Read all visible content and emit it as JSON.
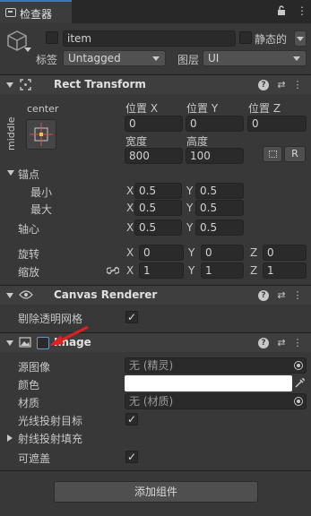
{
  "tab": {
    "title": "检查器"
  },
  "object": {
    "name": "item",
    "static_label": "静态的",
    "tag_label": "标签",
    "tag_value": "Untagged",
    "layer_label": "图层",
    "layer_value": "UI"
  },
  "rect_transform": {
    "title": "Rect Transform",
    "anchor_h": "center",
    "anchor_v": "middle",
    "pos_x_label": "位置 X",
    "pos_x": "0",
    "pos_y_label": "位置 Y",
    "pos_y": "0",
    "pos_z_label": "位置 Z",
    "pos_z": "0",
    "width_label": "宽度",
    "width": "800",
    "height_label": "高度",
    "height": "100",
    "r_button": "R",
    "anchors_label": "锚点",
    "min_label": "最小",
    "min_x": "0.5",
    "min_y": "0.5",
    "max_label": "最大",
    "max_x": "0.5",
    "max_y": "0.5",
    "pivot_label": "轴心",
    "pivot_x": "0.5",
    "pivot_y": "0.5",
    "rotation_label": "旋转",
    "rot_x": "0",
    "rot_y": "0",
    "rot_z": "0",
    "scale_label": "缩放",
    "scale_x": "1",
    "scale_y": "1",
    "scale_z": "1",
    "axis_x": "X",
    "axis_y": "Y",
    "axis_z": "Z"
  },
  "canvas_renderer": {
    "title": "Canvas Renderer",
    "cull_label": "剔除透明网格"
  },
  "image": {
    "title": "Image",
    "source_label": "源图像",
    "source_value": "无 (精灵)",
    "color_label": "颜色",
    "material_label": "材质",
    "material_value": "无 (材质)",
    "raycast_label": "光线投射目标",
    "padding_label": "射线投射填充",
    "maskable_label": "可遮盖"
  },
  "add_component": "添加组件",
  "colors": {
    "accent": "#3a79bb",
    "bg": "#383838",
    "annotation_arrow": "#e02020"
  }
}
